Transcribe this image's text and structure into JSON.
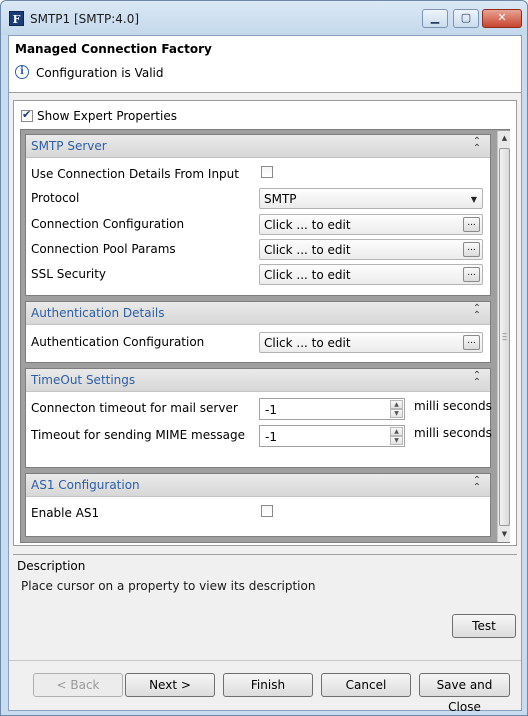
{
  "window": {
    "title": "SMTP1 [SMTP:4.0]",
    "app_icon_letter": "F",
    "buttons": {
      "minimize": "▁",
      "maximize": "▢",
      "close": "✕"
    }
  },
  "header": {
    "title": "Managed Connection Factory",
    "status": "Configuration is Valid",
    "status_icon": "info-icon"
  },
  "expert": {
    "label": "Show Expert Properties",
    "checked": true
  },
  "sections": {
    "smtp": {
      "title": "SMTP Server",
      "rows": {
        "use_input": {
          "label": "Use Connection Details From Input",
          "checked": false
        },
        "protocol": {
          "label": "Protocol",
          "value": "SMTP"
        },
        "conn_config": {
          "label": "Connection Configuration",
          "value": "Click ... to edit"
        },
        "pool_params": {
          "label": "Connection Pool Params",
          "value": "Click ... to edit"
        },
        "ssl": {
          "label": "SSL Security",
          "value": "Click ... to edit"
        }
      }
    },
    "auth": {
      "title": "Authentication Details",
      "rows": {
        "auth_config": {
          "label": "Authentication Configuration",
          "value": "Click ... to edit"
        }
      }
    },
    "timeout": {
      "title": "TimeOut Settings",
      "rows": {
        "conn_timeout": {
          "label": "Connecton timeout for mail server",
          "value": "-1",
          "unit": "milli seconds"
        },
        "mime_timeout": {
          "label": "Timeout for sending MIME message",
          "value": "-1",
          "unit": "milli seconds"
        }
      }
    },
    "as1": {
      "title": "AS1 Configuration",
      "rows": {
        "enable": {
          "label": "Enable AS1",
          "checked": false
        }
      }
    }
  },
  "ellipsis": "...",
  "description": {
    "title": "Description",
    "text": "Place cursor on a property to view its description"
  },
  "buttons": {
    "test": "Test",
    "back": "< Back",
    "next": "Next >",
    "finish": "Finish",
    "cancel": "Cancel",
    "save_close": "Save and Close"
  }
}
